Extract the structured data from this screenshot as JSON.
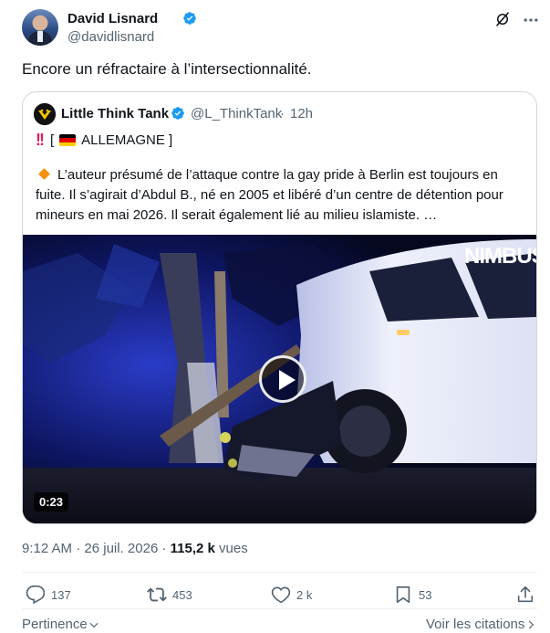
{
  "author": {
    "display_name": "David Lisnard",
    "handle": "@davidlisnard"
  },
  "tweet": {
    "text": "Encore un réfractaire à l’intersectionnalité."
  },
  "quoted": {
    "display_name": "Little Think Tank",
    "handle": "@L_ThinkTank",
    "separator": "·",
    "time": "12h",
    "headline_prefix": "[",
    "headline_label": "ALLEMAGNE ]",
    "body": "L’auteur présumé de l’attaque contre la gay pride à Berlin est toujours en fuite. Il s’agirait d’Abdul B., né en 2005 et libéré d’un centre de détention pour mineurs en mai 2026. Il serait également lié au milieu islamiste.  …",
    "video": {
      "duration": "0:23",
      "logo": "NIMBUS"
    }
  },
  "meta": {
    "time": "9:12 AM",
    "separator1": "·",
    "date": "26 juil. 2026",
    "separator2": "·",
    "views_count": "115,2 k",
    "views_label": "vues"
  },
  "actions": {
    "replies": "137",
    "reposts": "453",
    "likes": "2 k",
    "bookmarks": "53"
  },
  "footer": {
    "sort_label": "Pertinence",
    "quotes_link": "Voir les citations"
  },
  "icons": {
    "verified": "verified-badge-icon",
    "grok": "grok-icon",
    "more": "more-options-icon",
    "reply": "reply-icon",
    "repost": "repost-icon",
    "like": "like-icon",
    "bookmark": "bookmark-icon",
    "share": "share-icon"
  },
  "colors": {
    "verified_blue": "#1d9bf0",
    "text": "#0f1419",
    "muted": "#536471",
    "border": "#cfd9de"
  }
}
